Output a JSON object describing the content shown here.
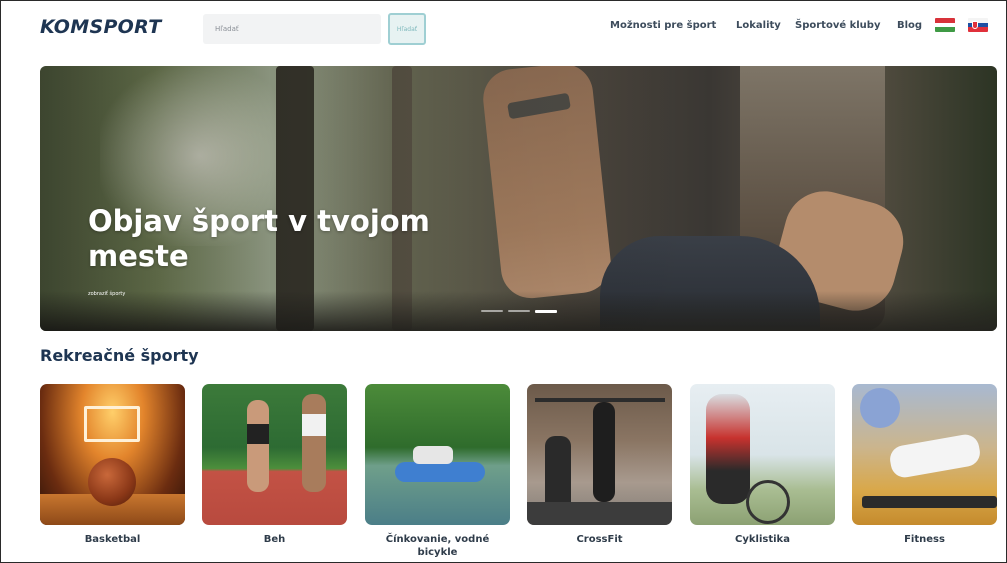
{
  "header": {
    "logo": "KOMSPORT",
    "search": {
      "placeholder": "Hľadať"
    },
    "search_button_label": "Hľadať",
    "nav": [
      {
        "label": "Možnosti pre šport"
      },
      {
        "label": "Lokality"
      },
      {
        "label": "Športové kluby"
      },
      {
        "label": "Blog"
      }
    ],
    "languages": [
      {
        "icon": "hungary-flag-icon"
      },
      {
        "icon": "slovakia-flag-icon"
      }
    ]
  },
  "hero": {
    "title": "Objav šport v tvojom meste",
    "link": "zobraziť športy",
    "slides": 3,
    "active_slide": 3
  },
  "section": {
    "title": "Rekreačné športy",
    "cards": [
      {
        "label": "Basketbal"
      },
      {
        "label": "Beh"
      },
      {
        "label": "Čínkovanie, vodné bicykle"
      },
      {
        "label": "CrossFit"
      },
      {
        "label": "Cyklistika"
      },
      {
        "label": "Fitness"
      }
    ]
  },
  "colors": {
    "brand": "#1e3552",
    "search_button_border": "#9fcfd3",
    "flag_hu": [
      "#d8323a",
      "#ffffff",
      "#3f9a45"
    ],
    "flag_sk": [
      "#f4f4f4",
      "#1f4fa3",
      "#e0303b"
    ]
  }
}
